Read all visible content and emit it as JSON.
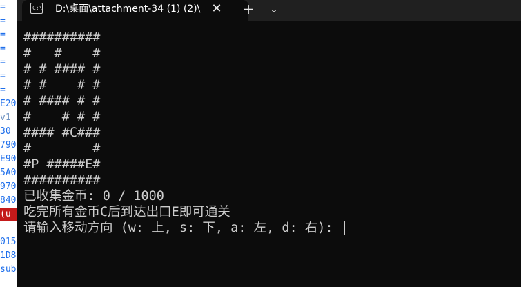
{
  "left_strip": {
    "lines": [
      {
        "text": "=",
        "style": "normal"
      },
      {
        "text": "=",
        "style": "normal"
      },
      {
        "text": "=",
        "style": "normal"
      },
      {
        "text": "=",
        "style": "normal"
      },
      {
        "text": "=",
        "style": "normal"
      },
      {
        "text": "=",
        "style": "normal"
      },
      {
        "text": "=",
        "style": "normal"
      },
      {
        "text": "E20",
        "style": "normal"
      },
      {
        "text": "v1",
        "style": "dim"
      },
      {
        "text": "30",
        "style": "normal"
      },
      {
        "text": "790",
        "style": "normal"
      },
      {
        "text": "E90",
        "style": "normal"
      },
      {
        "text": "5A0",
        "style": "normal"
      },
      {
        "text": "970",
        "style": "normal"
      },
      {
        "text": "840",
        "style": "normal"
      },
      {
        "text": "(u",
        "style": "err"
      },
      {
        "text": "",
        "style": "normal"
      },
      {
        "text": "015",
        "style": "normal"
      },
      {
        "text": "1D8",
        "style": "normal"
      },
      {
        "text": "sub",
        "style": "normal"
      }
    ]
  },
  "tabbar": {
    "tab_title": "D:\\桌面\\attachment-34 (1) (2)\\",
    "close_glyph": "✕",
    "new_tab_glyph": "+",
    "dropdown_glyph": "⌄",
    "icon_glyph": "C:\\"
  },
  "console": {
    "lines": [
      "##########",
      "#   #    #",
      "# # #### #",
      "# #    # #",
      "# #### # #",
      "#    # # #",
      "#### #C###",
      "#        #",
      "#P #####E#",
      "##########",
      "已收集金币: 0 / 1000",
      "吃完所有金币C后到达出口E即可通关",
      "请输入移动方向 (w: 上, s: 下, a: 左, d: 右): "
    ]
  }
}
